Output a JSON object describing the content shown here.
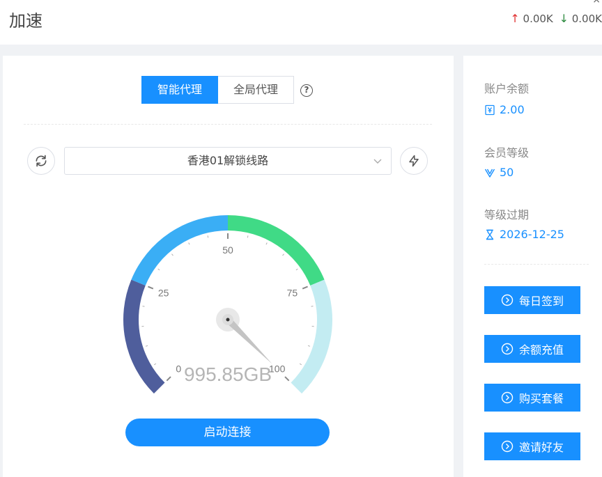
{
  "header": {
    "title": "加速",
    "upload_speed": "0.00K",
    "download_speed": "0.00K",
    "close_glyph": "×"
  },
  "proxy_mode": {
    "smart_label": "智能代理",
    "global_label": "全局代理",
    "selected": "smart_label",
    "help_glyph": "?"
  },
  "line": {
    "selected_value": "香港01解锁线路"
  },
  "gauge": {
    "min": 0,
    "max": 100,
    "value": 100,
    "tick_labels": [
      "0",
      "25",
      "50",
      "75",
      "100"
    ],
    "traffic_label": "995.85GB",
    "band_colors": [
      "#4f5e9c",
      "#3aaef5",
      "#40da86",
      "#c3ecf2"
    ]
  },
  "connect_label": "启动连接",
  "account": {
    "balance_label": "账户余额",
    "balance_value": "2.00",
    "level_label": "会员等级",
    "level_value": "50",
    "expire_label": "等级过期",
    "expire_value": "2026-12-25"
  },
  "actions": {
    "checkin": "每日签到",
    "recharge": "余额充值",
    "buy_plan": "购买套餐",
    "invite": "邀请好友"
  },
  "colors": {
    "accent": "#1890ff",
    "up_arrow": "#e03131",
    "down_arrow": "#2b8a3e"
  }
}
